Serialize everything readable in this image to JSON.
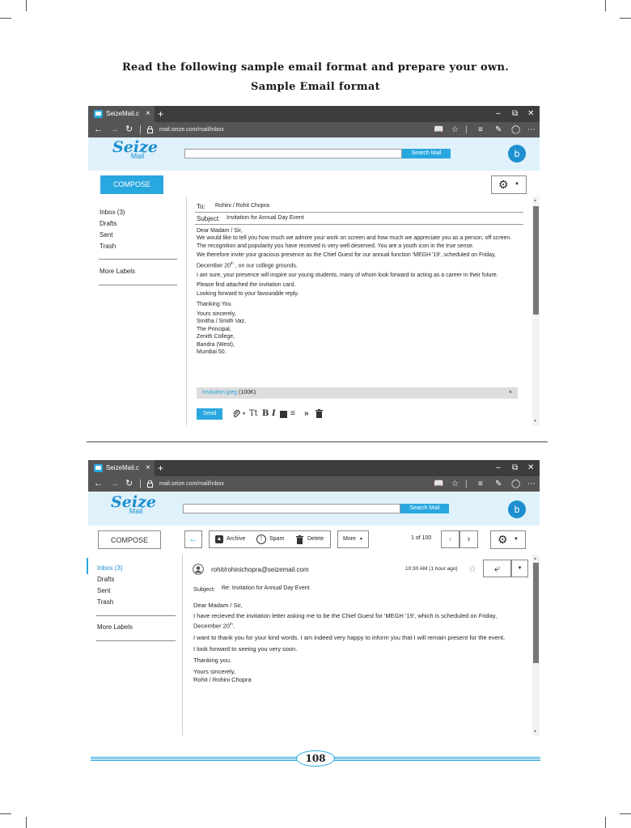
{
  "page": {
    "heading_line1": "Read the following sample email format and prepare your own.",
    "heading_line2": "Sample Email format",
    "page_number": "108"
  },
  "browser": {
    "tab_title": "SeizeMail.c",
    "tab_close": "×",
    "new_tab": "+",
    "url": "mail.seize.com/mail/inbox",
    "win_minimize": "–",
    "win_restore": "⧉",
    "win_close": "✕",
    "back": "←",
    "forward": "→",
    "refresh": "↻"
  },
  "app": {
    "logo_word": "Seize",
    "logo_sub": "Mail",
    "search_button": "Search Mail",
    "avatar_letter": "b",
    "compose": "COMPOSE"
  },
  "sidebar1": {
    "inbox": "Inbox (3)",
    "drafts": "Drafts",
    "sent": "Sent",
    "trash": "Trash",
    "more": "More Labels"
  },
  "sidebar2": {
    "inbox": "Inbox (3)",
    "drafts": "Drafts",
    "sent": "Sent",
    "trash": "Trash",
    "more": "More Labels"
  },
  "compose_view": {
    "to_label": "To:",
    "to_value": "Rohini / Rohit Chopra",
    "subject_label": "Subject:",
    "subject_value": "Invitation for Annual Day Event",
    "greeting": "Dear Madam / Sir,",
    "para1": "We would like to tell you how much we admire your work on screen and how much we appreciate you as a person, off screen. The recognition and popularity you have received is very well deserved. You are a youth icon in the true sense.",
    "para2_a": "We therefore invite your gracious presence as the Chief Guest for our annual function 'MEGH '19', scheduled on Friday, December 20",
    "para2_sup": "th",
    "para2_b": " , on our college grounds.",
    "para3": "I am sure, your presence  will inspire our young students, many of whom look forward to acting as a career in their future.",
    "para4": "Please find attached the invitation card.",
    "para5": "Looking forward to your favourable reply.",
    "para6": "Thanking You.",
    "sign1": "Yours sincerely,",
    "sign2": "Smitha / Smith Vaz,",
    "sign3": "The Principal,",
    "sign4": "Zenith College,",
    "sign5": "Bandra (West),",
    "sign6": "Mumbai 50.",
    "attachment_name": "Invitation.jpeg",
    "attachment_size": " (100K)",
    "attachment_remove": "×",
    "send": "Send",
    "fmt_text": "Tt",
    "fmt_bold": "B",
    "fmt_italic": "I"
  },
  "read_view": {
    "toolbar": {
      "archive": "Archive",
      "spam": "Spam",
      "delete": "Delete",
      "more": "More",
      "count": "1 of 100"
    },
    "from": "rohit/rohinichopra@seizemail.com",
    "time": "10:30 AM (1 hour ago)",
    "subject_label": "Subject:",
    "subject_value": "Re:  Invitation for Annual Day Event",
    "greeting": "Dear Madam / Sir,",
    "para1_a": "I have recieved the invitation letter asking me to be the Chief Guest for 'MEGH '19', which is scheduled on Friday, December  20",
    "para1_sup": "th",
    "para1_b": ".",
    "para2": "I want to thank you for your kind words. I am indeed very happy to inform you that I will remain present for the event.",
    "para3": "I look forward to seeing you very soon.",
    "para4": "Thanking you.",
    "sign1": "Yours sincerely,",
    "sign2": "Rohit / Rohini Chopra"
  },
  "colors": {
    "accent": "#29a7df",
    "header_bg": "#dff1fb",
    "titlebar": "#3d3d3d",
    "urlbar": "#555555",
    "scroll_thumb": "#777777"
  },
  "icons": [
    "mail-icon",
    "lock-icon",
    "reading-view-icon",
    "star-icon",
    "hub-icon",
    "note-icon",
    "extensions-icon",
    "more-icon",
    "gear-icon",
    "paperclip-icon",
    "trash-icon",
    "reply-icon",
    "user-icon",
    "archive-icon",
    "spam-icon"
  ]
}
